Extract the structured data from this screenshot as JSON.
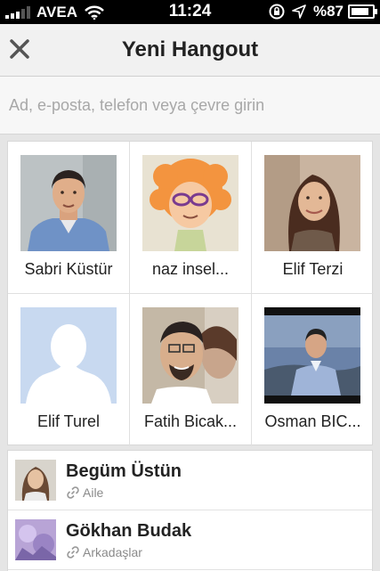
{
  "status_bar": {
    "carrier": "AVEA",
    "time": "11:24",
    "battery": "%87",
    "battery_level": 0.87
  },
  "header": {
    "title": "Yeni Hangout",
    "close_icon": "close-icon"
  },
  "search": {
    "placeholder": "Ad, e-posta, telefon veya çevre girin",
    "value": ""
  },
  "suggested_contacts": [
    {
      "name": "Sabri Küstür",
      "avatar": "photo"
    },
    {
      "name": "naz insel...",
      "avatar": "cartoon"
    },
    {
      "name": "Elif Terzi",
      "avatar": "photo"
    },
    {
      "name": "Elif Turel",
      "avatar": "default-silhouette"
    },
    {
      "name": "Fatih Bicak...",
      "avatar": "photo"
    },
    {
      "name": "Osman BIC...",
      "avatar": "photo"
    }
  ],
  "contact_list": [
    {
      "name": "Begüm Üstün",
      "circle": "Aile",
      "circle_icon": "link-icon"
    },
    {
      "name": "Gökhan Budak",
      "circle": "Arkadaşlar",
      "circle_icon": "link-icon"
    }
  ]
}
